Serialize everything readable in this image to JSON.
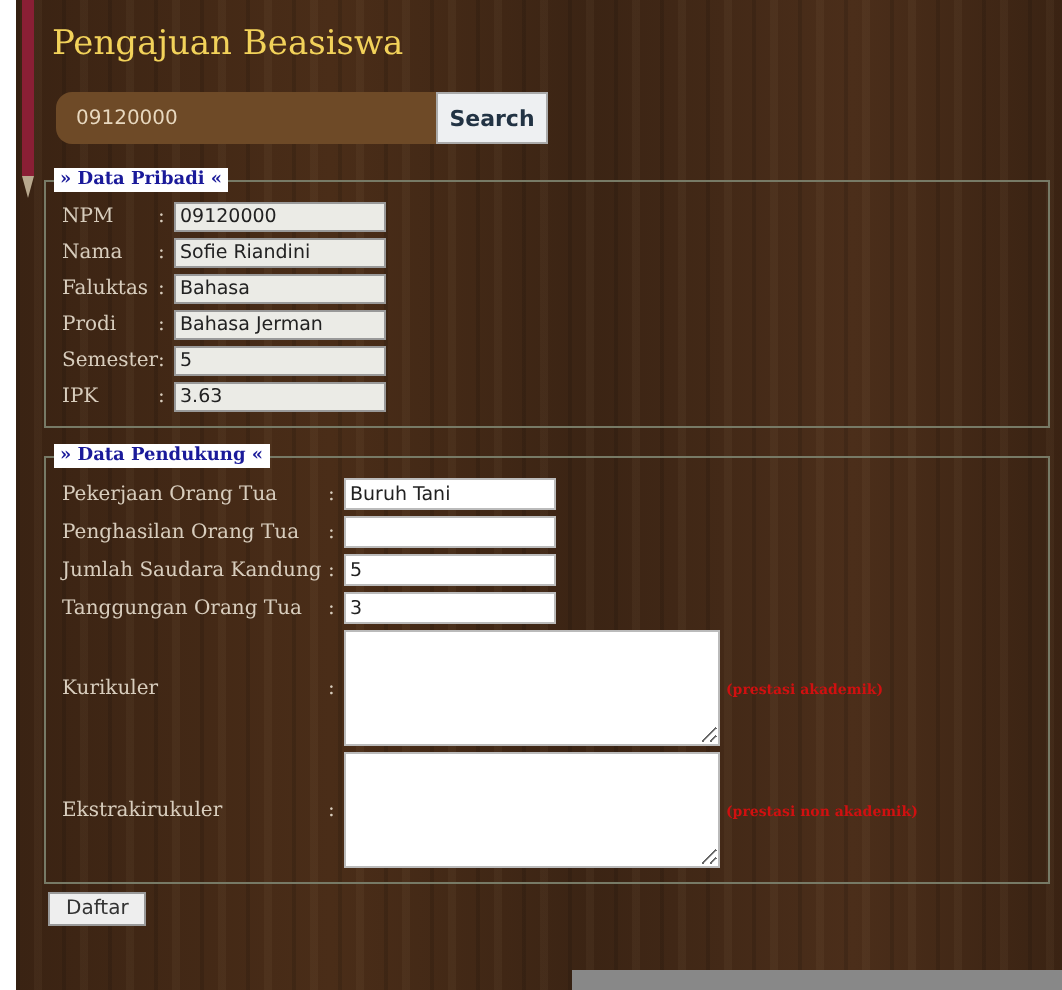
{
  "title": "Pengajuan Beasiswa",
  "search": {
    "value": "09120000",
    "button": "Search"
  },
  "personal": {
    "legend": "» Data Pribadi «",
    "fields": [
      {
        "label": "NPM",
        "separator": ":",
        "value": "09120000"
      },
      {
        "label": "Nama",
        "separator": ":",
        "value": "Sofie Riandini"
      },
      {
        "label": "Faluktas",
        "separator": ":",
        "value": "Bahasa"
      },
      {
        "label": "Prodi",
        "separator": ":",
        "value": "Bahasa Jerman"
      },
      {
        "label": "Semester",
        "separator": ":",
        "value": "5"
      },
      {
        "label": "IPK",
        "separator": ":",
        "value": "3.63"
      }
    ]
  },
  "support": {
    "legend": "» Data Pendukung «",
    "fields": [
      {
        "kind": "input",
        "label": "Pekerjaan Orang Tua",
        "separator": ":",
        "value": "Buruh Tani"
      },
      {
        "kind": "input",
        "label": "Penghasilan Orang Tua",
        "separator": ":"
      },
      {
        "kind": "input",
        "label": "Jumlah Saudara Kandung",
        "separator": ":",
        "value": "5"
      },
      {
        "kind": "input",
        "label": "Tanggungan Orang Tua",
        "separator": ":",
        "value": "3"
      },
      {
        "kind": "textarea",
        "label": "Kurikuler",
        "separator": ":",
        "note": "(prestasi akademik)"
      },
      {
        "kind": "textarea",
        "label": "Ekstrakirukuler",
        "separator": ":",
        "note": "(prestasi non akademik)"
      }
    ]
  },
  "submit": "Daftar"
}
